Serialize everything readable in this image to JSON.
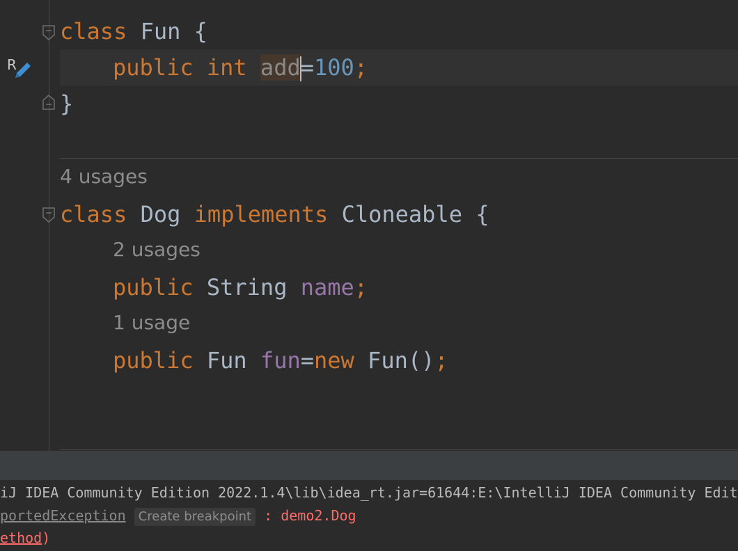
{
  "editor": {
    "class_fun": {
      "kw_class": "class",
      "name": "Fun",
      "brace": "{",
      "field_line": {
        "kw_public": "public",
        "kw_int": "int",
        "name": "add",
        "assign": "=",
        "value": "100",
        "semicolon": ";"
      },
      "close_brace": "}"
    },
    "class_dog": {
      "usages_hint": "4 usages",
      "kw_class": "class",
      "name": "Dog",
      "kw_implements": "implements",
      "iface": "Cloneable",
      "brace": "{",
      "field1_hint": "2 usages",
      "field1": {
        "kw_public": "public",
        "type": "String",
        "name": "name",
        "semicolon": ";"
      },
      "field2_hint": "1 usage",
      "field2": {
        "kw_public": "public",
        "type": "Fun",
        "name": "fun",
        "assign": "=",
        "kw_new": "new",
        "ctor": "Fun()",
        "semicolon": ";"
      }
    },
    "rename_icon_letter": "R"
  },
  "console": {
    "line1": "iJ IDEA Community Edition 2022.1.4\\lib\\idea_rt.jar=61644:E:\\IntelliJ IDEA Community Edit",
    "line2_link": "portedException",
    "line2_chip": "Create breakpoint",
    "line2_rest": " : demo2.Dog",
    "line3_link": "ethod",
    "line3_rest": ")"
  },
  "colors": {
    "keyword": "#cc7832",
    "number": "#6897bb",
    "field": "#9876aa",
    "text": "#a9b7c6",
    "error": "#ff6b68"
  }
}
